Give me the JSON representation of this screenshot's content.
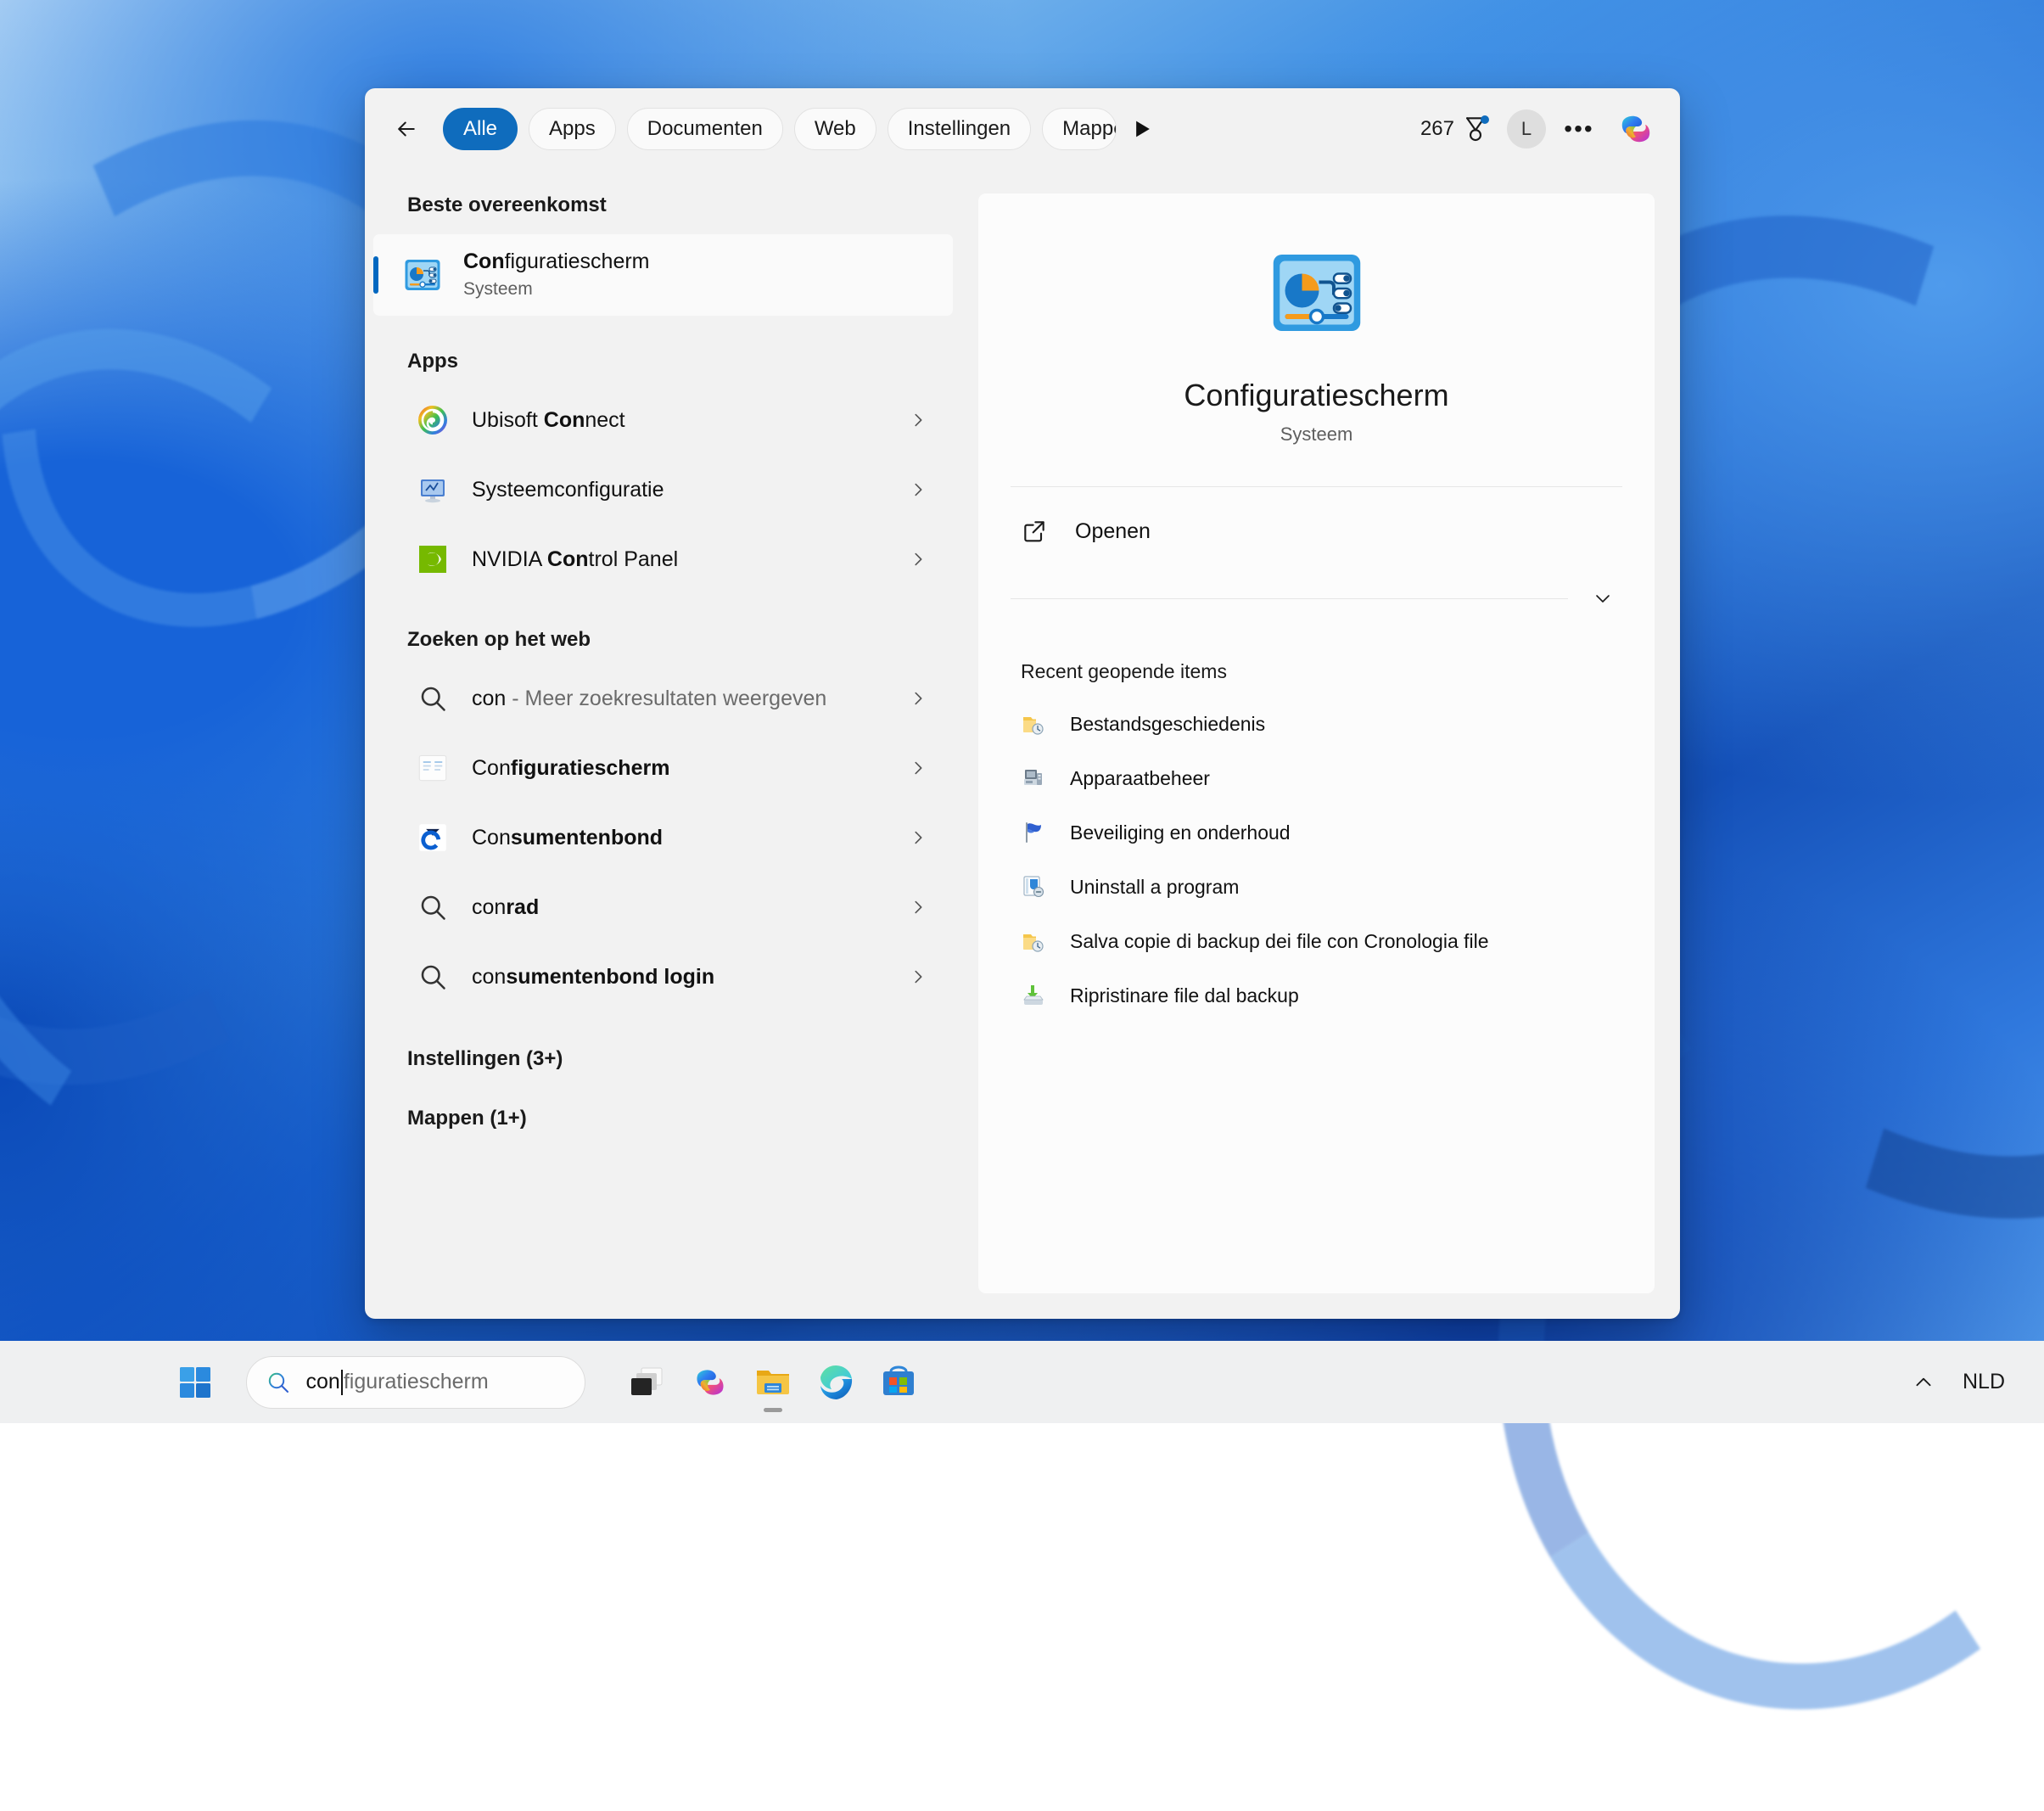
{
  "query": {
    "typed": "con",
    "suggestion_suffix": "figuratiescherm"
  },
  "tabbar": {
    "back_label": "Terug",
    "tabs": [
      {
        "label": "Alle",
        "active": true
      },
      {
        "label": "Apps",
        "active": false
      },
      {
        "label": "Documenten",
        "active": false
      },
      {
        "label": "Web",
        "active": false
      },
      {
        "label": "Instellingen",
        "active": false
      },
      {
        "label": "Mappen",
        "active": false
      }
    ],
    "scroll_next_label": "Meer tabbladen",
    "rewards_count": "267",
    "avatar_initial": "L",
    "more_label": "•••",
    "copilot_label": "Copilot"
  },
  "results": {
    "best_match_heading": "Beste overeenkomst",
    "best_match": {
      "title_bold": "Con",
      "title_rest": "figuratiescherm",
      "subtitle": "Systeem"
    },
    "apps_heading": "Apps",
    "apps": [
      {
        "pre": "Ubisoft ",
        "bold": "Con",
        "post": "nect"
      },
      {
        "pre": "Systeemconfiguratie",
        "bold": "",
        "post": ""
      },
      {
        "pre": "NVIDIA ",
        "bold": "Con",
        "post": "trol Panel"
      }
    ],
    "web_heading": "Zoeken op het web",
    "web": [
      {
        "pre": "con",
        "bold": "",
        "post": "",
        "suffix": " - Meer zoekresultaten weergeven",
        "icon": "search-icon"
      },
      {
        "pre": "Con",
        "bold": "figuratiescherm",
        "post": "",
        "suffix": "",
        "icon": "favicon-page"
      },
      {
        "pre": "Con",
        "bold": "sumentenbond",
        "post": "",
        "suffix": "",
        "icon": "favicon-consumentenbond"
      },
      {
        "pre": "con",
        "bold": "rad",
        "post": "",
        "suffix": "",
        "icon": "search-icon"
      },
      {
        "pre": "con",
        "bold": "sumentenbond login",
        "post": "",
        "suffix": "",
        "icon": "search-icon"
      }
    ],
    "settings_heading": "Instellingen (3+)",
    "folders_heading": "Mappen (1+)"
  },
  "preview": {
    "title": "Configuratiescherm",
    "subtitle": "Systeem",
    "open_label": "Openen",
    "expander_label": "Meer weergeven",
    "recent_heading": "Recent geopende items",
    "recent_items": [
      {
        "label": "Bestandsgeschiedenis",
        "icon": "folder-clock-icon"
      },
      {
        "label": "Apparaatbeheer",
        "icon": "device-manager-icon"
      },
      {
        "label": "Beveiliging en onderhoud",
        "icon": "flag-icon"
      },
      {
        "label": "Uninstall a program",
        "icon": "uninstall-icon"
      },
      {
        "label": "Salva copie di backup dei file con Cronologia file",
        "icon": "folder-clock-icon"
      },
      {
        "label": "Ripristinare file dal backup",
        "icon": "restore-icon"
      }
    ]
  },
  "taskbar": {
    "start_label": "Start",
    "search_typed": "con",
    "search_suggestion": "figuratiescherm",
    "apps": [
      {
        "name": "Taakweergave",
        "icon": "task-view-icon",
        "running": false
      },
      {
        "name": "Copilot",
        "icon": "copilot-icon",
        "running": false
      },
      {
        "name": "Verkenner",
        "icon": "file-explorer-icon",
        "running": true
      },
      {
        "name": "Microsoft Edge",
        "icon": "edge-icon",
        "running": false
      },
      {
        "name": "Microsoft Store",
        "icon": "store-icon",
        "running": false
      }
    ],
    "tray_chevron_label": "Verborgen pictogrammen weergeven",
    "language": "NLD"
  },
  "colors": {
    "accent": "#0f6cbd",
    "selection_bar": "#0067c0",
    "flyout_bg": "#f2f2f2",
    "preview_bg": "#fcfcfc",
    "taskbar_bg": "#eff0f1"
  }
}
